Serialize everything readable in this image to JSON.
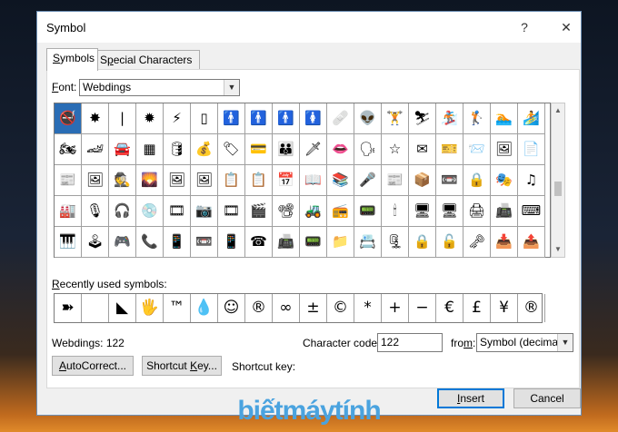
{
  "window": {
    "title": "Symbol",
    "help_label": "?",
    "close_label": "✕"
  },
  "tabs": [
    {
      "label": "Symbols",
      "underline_char": "S",
      "rest": "ymbols",
      "active": true
    },
    {
      "label": "Special Characters",
      "underline_pre": "S",
      "underline_char": "p",
      "rest": "ecial Characters",
      "active": false
    }
  ],
  "font": {
    "label_pre": "",
    "label_u": "F",
    "label_rest": "ont:",
    "value": "Webdings"
  },
  "symbol_grid": {
    "rows": [
      [
        "🚭",
        "✸",
        "|",
        "✹",
        "⚡",
        "▯",
        "🚹",
        "🚹",
        "🚹",
        "🚺",
        "🩹",
        "👽",
        "🏋",
        "⛷",
        "🏂",
        "🏌",
        "🏊",
        "🏄"
      ],
      [
        "🏍",
        "🏎",
        "🚘",
        "▦",
        "🛢",
        "💰",
        "🏷",
        "💳",
        "👪",
        "🗡",
        "👄",
        "🗣",
        "☆",
        "✉",
        "🎫",
        "📨",
        "🖼",
        "📄"
      ],
      [
        "📰",
        "🖼",
        "🕵",
        "🌄",
        "🖼",
        "🖼",
        "📋",
        "📋",
        "📅",
        "📖",
        "📚",
        "🎤",
        "📰",
        "📦",
        "📼",
        "🔒",
        "🎭",
        "♫"
      ],
      [
        "🏭",
        "🎙",
        "🎧",
        "💿",
        "🎞",
        "📷",
        "🎞",
        "🎬",
        "📽",
        "🚜",
        "📻",
        "📟",
        "🕯",
        "🖥",
        "🖥",
        "🖨",
        "📠",
        "⌨"
      ],
      [
        "🎹",
        "🕹",
        "🎮",
        "📞",
        "📱",
        "📼",
        "📱",
        "☎",
        "📠",
        "📟",
        "📁",
        "📇",
        "🗜",
        "🔒",
        "🔓",
        "🗝",
        "📥",
        "📤"
      ]
    ],
    "selected": "🚭"
  },
  "recently_used": {
    "label_u": "R",
    "label_rest": "ecently used symbols:",
    "symbols": [
      "➽",
      "",
      "◣",
      "🖐",
      "™",
      "💧",
      "☺",
      "®",
      "∞",
      "±",
      "©",
      "*",
      "+",
      "−",
      "€",
      "£",
      "¥",
      "®"
    ]
  },
  "status": {
    "font_code_text": "Webdings: 122"
  },
  "character_code": {
    "label_pre": "Character code:",
    "value": "122",
    "from_pre": "fro",
    "from_u": "m",
    "from_rest": ":",
    "from_value": "Symbol (decimal)"
  },
  "buttons": {
    "autocorrect_u": "A",
    "autocorrect_rest": "utoCorrect...",
    "shortcut_pre": "Shortcut ",
    "shortcut_u": "K",
    "shortcut_rest": "ey...",
    "shortcut_key_label": "Shortcut key:",
    "insert_u": "I",
    "insert_rest": "nsert",
    "cancel": "Cancel"
  },
  "watermark": "biếtmáytính"
}
